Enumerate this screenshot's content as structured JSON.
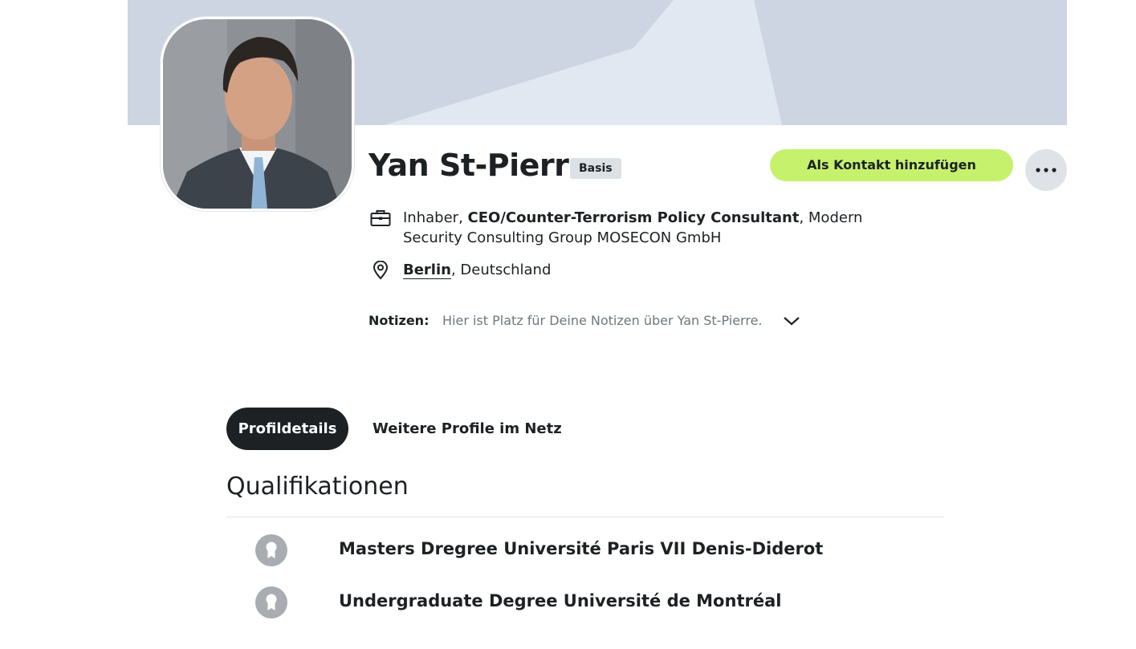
{
  "profile": {
    "name": "Yan St-Pierre",
    "membership_badge": "Basis",
    "add_contact_label": "Als Kontakt hinzufügen",
    "job": {
      "role": "Inhaber",
      "title": "CEO/Counter-Terrorism Policy Consultant",
      "company": "Modern Security Consulting Group MOSECON GmbH"
    },
    "location": {
      "city": "Berlin",
      "country": "Deutschland"
    }
  },
  "notes": {
    "label": "Notizen:",
    "placeholder": "Hier ist Platz für Deine Notizen über Yan St-Pierre."
  },
  "tabs": [
    {
      "label": "Profildetails",
      "active": true
    },
    {
      "label": "Weitere Profile im Netz",
      "active": false
    }
  ],
  "qualifications": {
    "title": "Qualifikationen",
    "items": [
      {
        "label": "Masters Dregree Université Paris VII Denis-Diderot"
      },
      {
        "label": "Undergraduate Degree Université de Montréal"
      }
    ]
  },
  "icons": {
    "job": "briefcase-icon",
    "location": "location-pin-icon",
    "notes_toggle": "chevron-down-icon",
    "more": "more-dots-icon",
    "qualification": "award-ribbon-icon"
  },
  "colors": {
    "accent": "#c6f16d",
    "cover": "#cdd5e2",
    "text": "#1d2124",
    "tab_active_bg": "#1d2124",
    "badge_bg": "#dce1e6"
  }
}
